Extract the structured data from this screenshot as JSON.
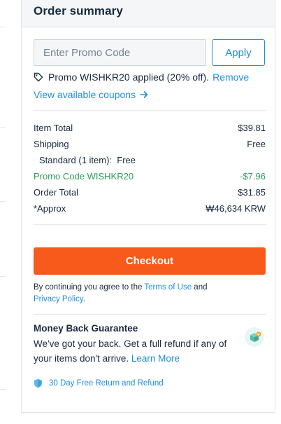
{
  "header": {
    "title": "Order summary"
  },
  "promo": {
    "placeholder": "Enter Promo Code",
    "apply_label": "Apply",
    "applied_text": "Promo WISHKR20 applied (20% off).",
    "remove_label": "Remove",
    "coupons_link": "View available coupons"
  },
  "summary": {
    "item_total_label": "Item Total",
    "item_total_value": "$39.81",
    "shipping_label": "Shipping",
    "shipping_value": "Free",
    "shipping_detail": "Standard (1 item):  Free",
    "promo_label": "Promo Code WISHKR20",
    "promo_value": "-$7.96",
    "order_total_label": "Order Total",
    "order_total_value": "$31.85",
    "approx_label": "*Approx",
    "approx_value": "₩46,634 KRW"
  },
  "checkout": {
    "label": "Checkout"
  },
  "terms": {
    "prefix": "By continuing you agree to the ",
    "terms_link": "Terms of Use",
    "middle": " and",
    "privacy_link": "Privacy Policy",
    "suffix": "."
  },
  "guarantee": {
    "title": "Money Back Guarantee",
    "text": "We've got your back. Get a full refund if any of your items don't arrive. ",
    "learn_more": "Learn More",
    "return_text": "30 Day Free Return and Refund"
  },
  "colors": {
    "accent": "#1d8fd8",
    "checkout": "#f75a1b",
    "success": "#2e9d5b",
    "header_bg": "#f4f6f8"
  },
  "icons": [
    "tag-icon",
    "arrow-right-icon",
    "box-icon",
    "shield-icon"
  ]
}
